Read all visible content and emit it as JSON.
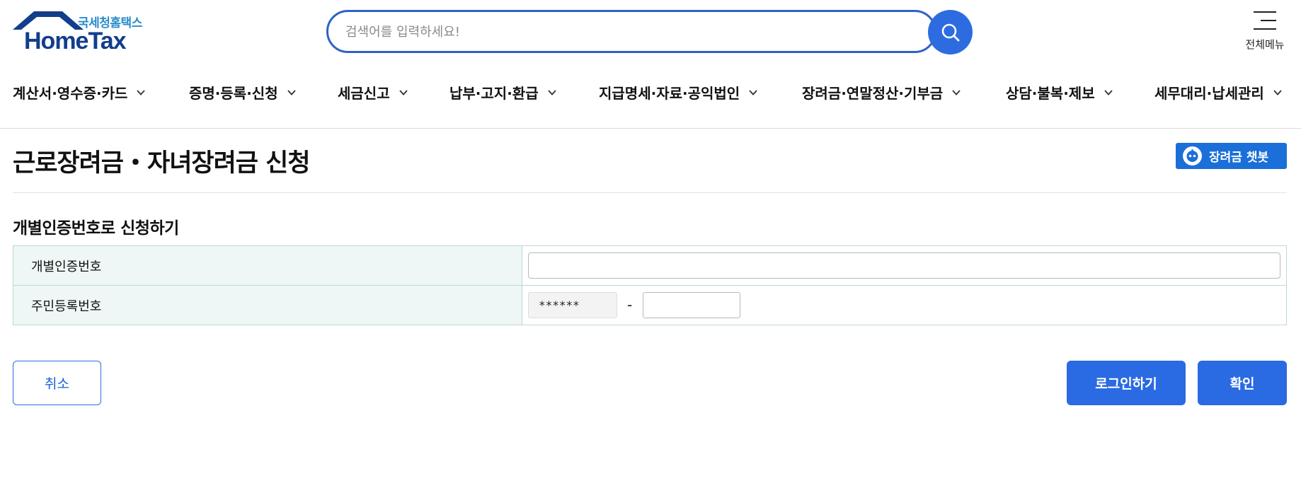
{
  "header": {
    "logo_sub": "국세청홈택스",
    "logo_main": "HomeTax",
    "search_placeholder": "검색어를 입력하세요!",
    "search_icon": "search-icon",
    "allmenu_label": "전체메뉴",
    "allmenu_icon": "hamburger-icon"
  },
  "nav": {
    "items": [
      {
        "label": "계산서·영수증·카드"
      },
      {
        "label": "증명·등록·신청"
      },
      {
        "label": "세금신고"
      },
      {
        "label": "납부·고지·환급"
      },
      {
        "label": "지급명세·자료·공익법인"
      },
      {
        "label": "장려금·연말정산·기부금"
      },
      {
        "label": "상담·불복·제보"
      },
      {
        "label": "세무대리·납세관리"
      }
    ]
  },
  "page": {
    "title": "근로장려금・자녀장려금 신청",
    "chatbot_label": "장려금 챗봇"
  },
  "section": {
    "title": "개별인증번호로 신청하기",
    "rows": [
      {
        "label": "개별인증번호",
        "value": ""
      },
      {
        "label": "주민등록번호",
        "front_value": "******",
        "separator": "-",
        "back_value": ""
      }
    ]
  },
  "actions": {
    "cancel_label": "취소",
    "login_label": "로그인하기",
    "confirm_label": "확인"
  },
  "colors": {
    "primary": "#2a6ae2",
    "logo_navy": "#123e8c",
    "logo_sub": "#2a8ccc",
    "table_header_bg": "#eef7f5",
    "table_border": "#bcd9d6"
  }
}
